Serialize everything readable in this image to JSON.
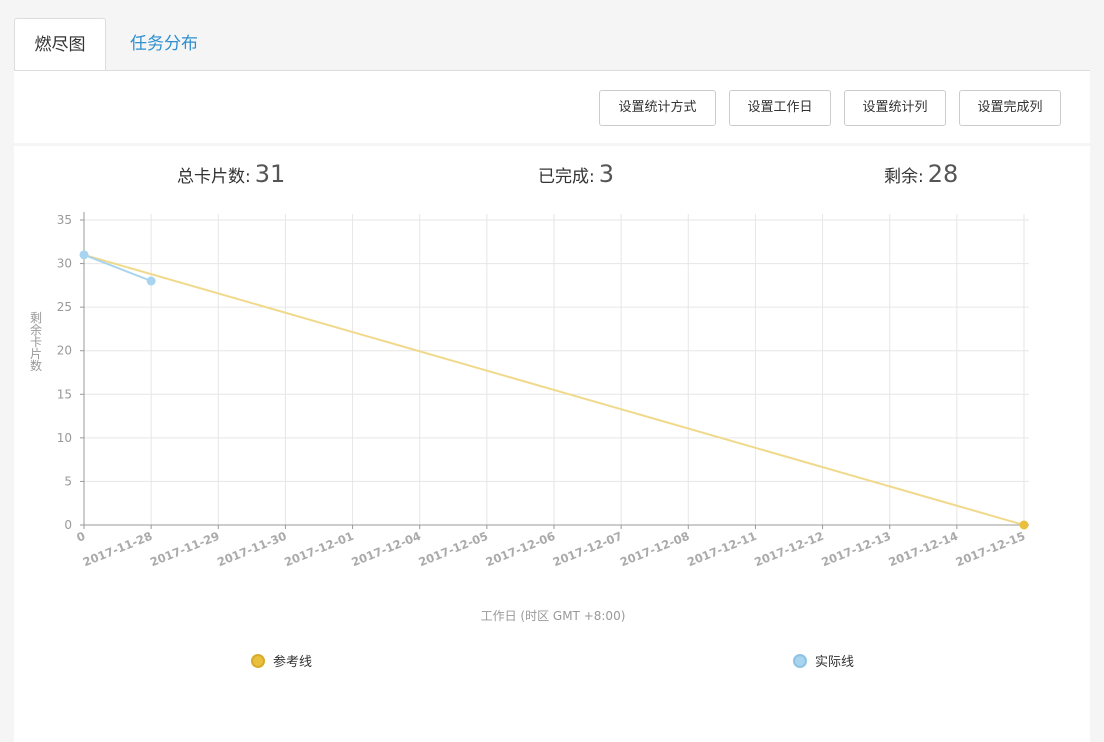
{
  "tabs": [
    {
      "label": "燃尽图",
      "active": true
    },
    {
      "label": "任务分布",
      "active": false
    }
  ],
  "toolbar": {
    "buttons": [
      "设置统计方式",
      "设置工作日",
      "设置统计列",
      "设置完成列"
    ]
  },
  "stats": {
    "total_label": "总卡片数:",
    "total_value": "31",
    "done_label": "已完成:",
    "done_value": "3",
    "remain_label": "剩余:",
    "remain_value": "28"
  },
  "chart_data": {
    "type": "line",
    "categories": [
      "0",
      "2017-11-28",
      "2017-11-29",
      "2017-11-30",
      "2017-12-01",
      "2017-12-04",
      "2017-12-05",
      "2017-12-06",
      "2017-12-07",
      "2017-12-08",
      "2017-12-11",
      "2017-12-12",
      "2017-12-13",
      "2017-12-14",
      "2017-12-15"
    ],
    "series": [
      {
        "name": "参考线",
        "color": "#f0d98a",
        "marker_color": "#e9bf3c",
        "points": [
          {
            "x": 0,
            "y": 31
          },
          {
            "x": 14,
            "y": 0
          }
        ]
      },
      {
        "name": "实际线",
        "color": "#a8d4ef",
        "marker_color": "#a8d4ef",
        "points": [
          {
            "x": 0,
            "y": 31
          },
          {
            "x": 1,
            "y": 28
          }
        ]
      }
    ],
    "xlabel": "工作日 (时区 GMT +8:00)",
    "ylabel": "剩余卡片数",
    "ylim": [
      0,
      35
    ],
    "yticks": [
      0,
      5,
      10,
      15,
      20,
      25,
      30,
      35
    ],
    "grid": true,
    "legend_position": "bottom"
  }
}
